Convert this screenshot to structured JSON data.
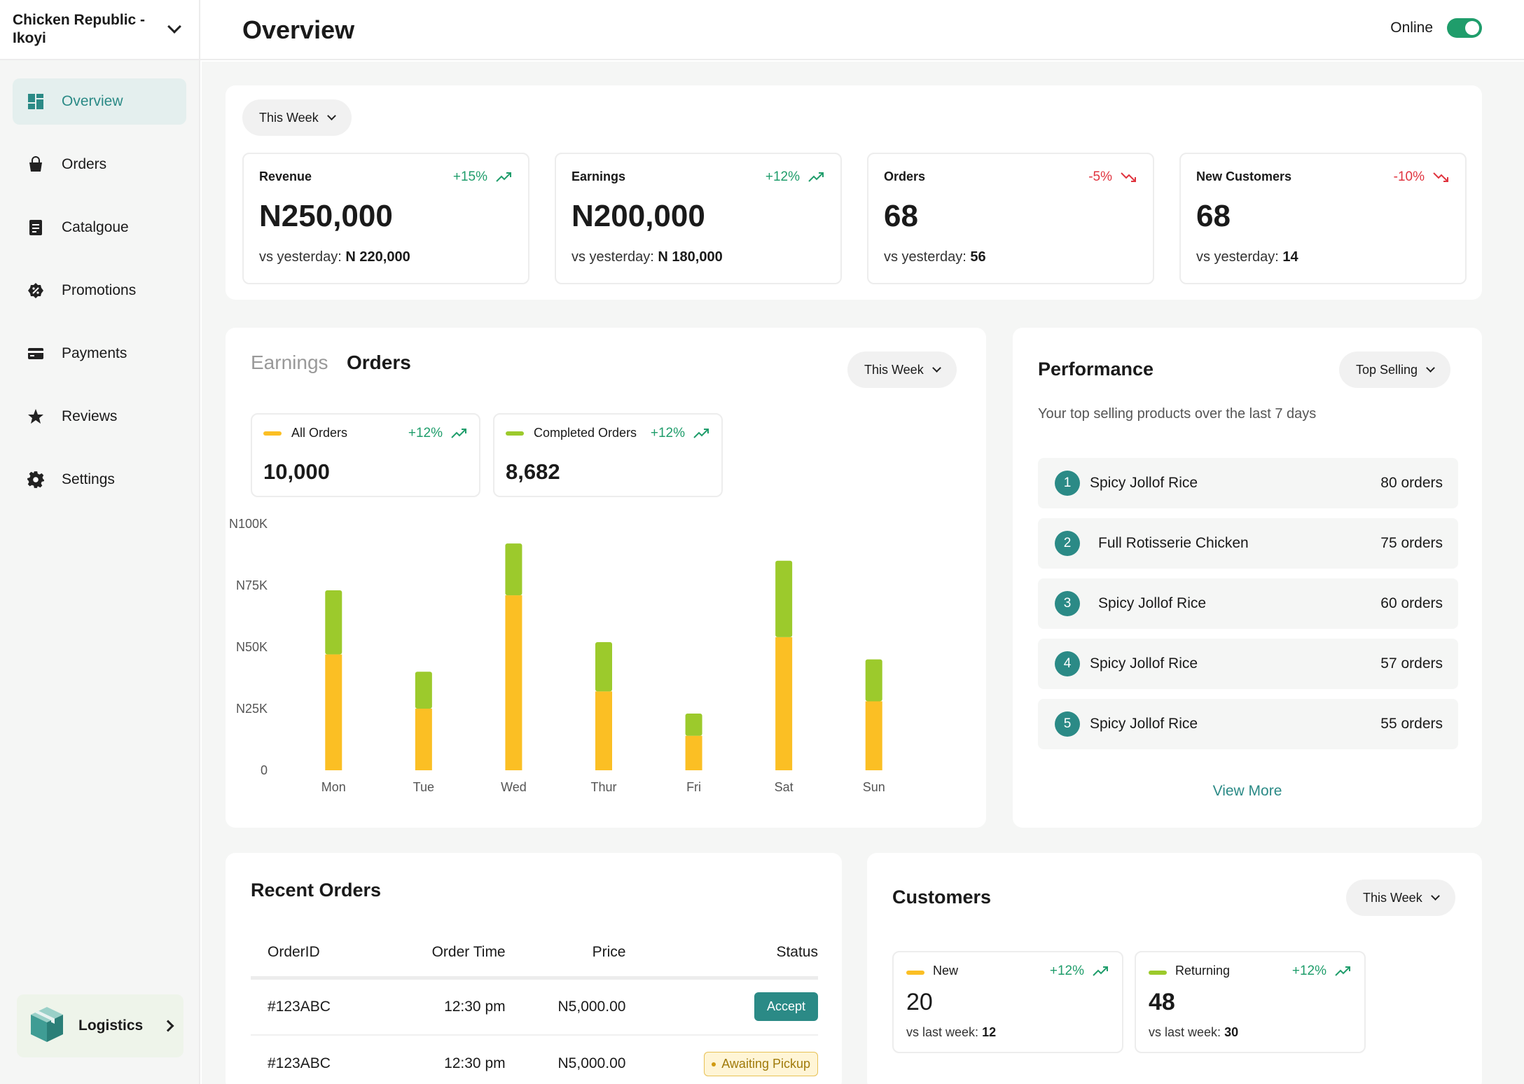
{
  "store": {
    "name": "Chicken Republic - Ikoyi"
  },
  "sidebar": {
    "items": [
      {
        "label": "Overview",
        "icon": "dashboard-icon"
      },
      {
        "label": "Orders",
        "icon": "bag-icon"
      },
      {
        "label": "Catalgoue",
        "icon": "document-icon"
      },
      {
        "label": "Promotions",
        "icon": "discount-icon"
      },
      {
        "label": "Payments",
        "icon": "card-icon"
      },
      {
        "label": "Reviews",
        "icon": "star-icon"
      },
      {
        "label": "Settings",
        "icon": "gear-icon"
      }
    ],
    "logistics": "Logistics"
  },
  "header": {
    "title": "Overview",
    "online_label": "Online",
    "online": true
  },
  "summary": {
    "period": "This Week",
    "kpis": [
      {
        "title": "Revenue",
        "change": "+15%",
        "trend": "up",
        "value": "N250,000",
        "compare_label": "vs yesterday:",
        "compare_value": "N 220,000"
      },
      {
        "title": "Earnings",
        "change": "+12%",
        "trend": "up",
        "value": "N200,000",
        "compare_label": "vs yesterday:",
        "compare_value": "N 180,000"
      },
      {
        "title": "Orders",
        "change": "-5%",
        "trend": "down",
        "value": "68",
        "compare_label": "vs yesterday:",
        "compare_value": "56"
      },
      {
        "title": "New Customers",
        "change": "-10%",
        "trend": "down",
        "value": "68",
        "compare_label": "vs yesterday:",
        "compare_value": "14"
      }
    ]
  },
  "orders_chart": {
    "tabs": [
      "Earnings",
      "Orders"
    ],
    "active_tab": "Orders",
    "period": "This Week",
    "all_orders": {
      "label": "All Orders",
      "change": "+12%",
      "value": "10,000"
    },
    "completed_orders": {
      "label": "Completed Orders",
      "change": "+12%",
      "value": "8,682"
    }
  },
  "chart_data": {
    "type": "bar",
    "stacked": true,
    "categories": [
      "Mon",
      "Tue",
      "Wed",
      "Thur",
      "Fri",
      "Sat",
      "Sun"
    ],
    "series": [
      {
        "name": "All Orders",
        "color": "#fbbf24",
        "values": [
          47,
          25,
          71,
          32,
          14,
          54,
          28
        ]
      },
      {
        "name": "Completed Orders",
        "color": "#9cca2c",
        "values": [
          26,
          15,
          21,
          20,
          9,
          31,
          17
        ]
      }
    ],
    "y_ticks": [
      "0",
      "N25K",
      "N50K",
      "N75K",
      "N100K"
    ],
    "ylim": [
      0,
      100
    ],
    "grid": false
  },
  "performance": {
    "title": "Performance",
    "filter": "Top Selling",
    "subtitle": "Your top selling products over the last 7 days",
    "items": [
      {
        "rank": "1",
        "name": "Spicy Jollof Rice",
        "orders": "80 orders"
      },
      {
        "rank": "2",
        "name": "Full Rotisserie Chicken",
        "orders": "75 orders"
      },
      {
        "rank": "3",
        "name": "Spicy Jollof Rice",
        "orders": "60 orders"
      },
      {
        "rank": "4",
        "name": "Spicy Jollof Rice",
        "orders": "57 orders"
      },
      {
        "rank": "5",
        "name": "Spicy Jollof Rice",
        "orders": "55 orders"
      }
    ],
    "view_more": "View More"
  },
  "recent_orders": {
    "title": "Recent Orders",
    "columns": [
      "OrderID",
      "Order Time",
      "Price",
      "Status"
    ],
    "rows": [
      {
        "id": "#123ABC",
        "time": "12:30 pm",
        "price": "N5,000.00",
        "status": "Accept"
      },
      {
        "id": "#123ABC",
        "time": "12:30 pm",
        "price": "N5,000.00",
        "status": "Awaiting Pickup"
      }
    ]
  },
  "customers": {
    "title": "Customers",
    "period": "This Week",
    "new": {
      "label": "New",
      "change": "+12%",
      "value": "20",
      "compare_label": "vs last week:",
      "compare_value": "12"
    },
    "returning": {
      "label": "Returning",
      "change": "+12%",
      "value": "48",
      "compare_label": "vs last week:",
      "compare_value": "30"
    }
  },
  "colors": {
    "accent": "#2b8a86",
    "positive": "#1f9d6b",
    "negative": "#e0343f",
    "orders_bar": "#fbbf24",
    "completed_bar": "#9cca2c"
  }
}
